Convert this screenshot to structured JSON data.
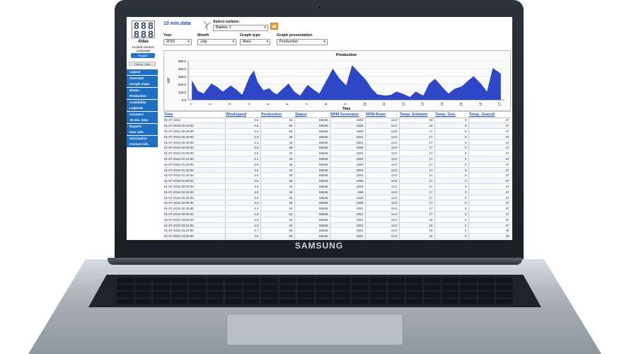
{
  "device": {
    "brand": "SAMSUNG"
  },
  "app": {
    "logo_text": "Atlas",
    "subtitle": "Hosted solution",
    "language_label": "Language",
    "language_value": "English",
    "theme_button": "Theme: Dark",
    "nav": [
      "Logout",
      "Overview",
      "Google maps",
      "Status",
      "Production",
      "Availability",
      "Logbook",
      "Counters",
      "10 min. data",
      "Reports",
      "User info.",
      "Information",
      "Contact info."
    ]
  },
  "page": {
    "title": "10 min.data",
    "select_turbine_label": "Select turbine:",
    "turbine_value": "Bække 1",
    "year_label": "Year",
    "year_value": "2015",
    "month_label": "Month",
    "month_value": "July",
    "graph_type_label": "Graph type",
    "graph_type_value": "Area",
    "graph_presentation_label": "Graph presentation",
    "graph_presentation_value": "Production"
  },
  "chart_data": {
    "type": "area",
    "title": "Production",
    "xlabel": "Time",
    "ylabel": "kW",
    "ylim": [
      0,
      580
    ],
    "yticks": [
      "580.0",
      "464.0",
      "348.0",
      "232.0",
      "116.0",
      "0.0"
    ],
    "xticks": [
      "1",
      "2",
      "3",
      "4",
      "5",
      "6",
      "7",
      "8",
      "9",
      "10",
      "11",
      "12",
      "13",
      "14",
      "15",
      "16",
      "17"
    ],
    "x": [
      1,
      1.3,
      1.6,
      2,
      2.3,
      2.6,
      3,
      3.3,
      3.6,
      4,
      4.2,
      4.4,
      4.7,
      5,
      5.2,
      5.4,
      5.7,
      6,
      6.3,
      6.6,
      7,
      7.3,
      7.6,
      8,
      8.3,
      8.6,
      9,
      9.3,
      9.6,
      10,
      10.3,
      10.6,
      11,
      11.3,
      11.6,
      12,
      12.3,
      12.6,
      13,
      13.3,
      13.6,
      14,
      14.3,
      14.6,
      15,
      15.3,
      15.6,
      16,
      16.3,
      16.6,
      17
    ],
    "values": [
      280,
      130,
      90,
      240,
      190,
      120,
      210,
      150,
      70,
      350,
      430,
      260,
      140,
      170,
      110,
      80,
      160,
      240,
      120,
      60,
      220,
      150,
      90,
      300,
      460,
      330,
      210,
      510,
      420,
      300,
      170,
      80,
      60,
      70,
      120,
      80,
      40,
      120,
      60,
      240,
      310,
      180,
      90,
      160,
      200,
      280,
      350,
      230,
      120,
      470,
      390
    ]
  },
  "table": {
    "headers": [
      "Time",
      "Windspeed",
      "Production",
      "Status",
      "RPM Generator",
      "RPM Rotor",
      "Temp. Ambient",
      "Temp. Gen.",
      "Temp. Gearoil"
    ],
    "rows": [
      [
        "01-07-2015",
        "4.8",
        "54",
        "65535",
        "1002",
        "13.0",
        "18",
        "0",
        "47"
      ],
      [
        "01-07-2015 00:10:00",
        "4.5",
        "52",
        "65535",
        "1000",
        "13.0",
        "18",
        "0",
        "47"
      ],
      [
        "01-07-2015 00:20:00",
        "4.4",
        "50",
        "65535",
        "1000",
        "13.0",
        "17",
        "0",
        "47"
      ],
      [
        "01-07-2015 00:30:00",
        "4.3",
        "46",
        "65535",
        "1001",
        "13.0",
        "17",
        "0",
        "47"
      ],
      [
        "01-07-2015 00:40:00",
        "4.1",
        "43",
        "65535",
        "1001",
        "13.0",
        "17",
        "0",
        "47"
      ],
      [
        "01-07-2015 00:50:00",
        "3.8",
        "38",
        "65535",
        "1000",
        "13.0",
        "17",
        "0",
        "47"
      ],
      [
        "01-07-2015 01:00:00",
        "3.8",
        "31",
        "65535",
        "1001",
        "13.0",
        "17",
        "0",
        "47"
      ],
      [
        "01-07-2015 01:10:00",
        "4.1",
        "40",
        "65535",
        "1000",
        "13.0",
        "17",
        "0",
        "47"
      ],
      [
        "01-07-2015 01:20:00",
        "3.9",
        "36",
        "65535",
        "1000",
        "13.0",
        "17",
        "0",
        "47"
      ],
      [
        "01-07-2015 01:30:00",
        "3.4",
        "24",
        "65535",
        "1001",
        "13.0",
        "17",
        "0",
        "47"
      ],
      [
        "01-07-2015 01:40:00",
        "3.5",
        "30",
        "65535",
        "1001",
        "13.0",
        "17",
        "0",
        "47"
      ],
      [
        "01-07-2015 01:50:00",
        "3.5",
        "26",
        "65535",
        "1000",
        "13.0",
        "17",
        "0",
        "47"
      ],
      [
        "01-07-2015 02:00:00",
        "3.4",
        "24",
        "65535",
        "1000",
        "13.0",
        "17",
        "0",
        "47"
      ],
      [
        "01-07-2015 02:10:00",
        "3.0",
        "19",
        "65535",
        "999",
        "13.0",
        "17",
        "0",
        "47"
      ],
      [
        "01-07-2015 02:20:00",
        "3.6",
        "30",
        "65535",
        "1000",
        "13.0",
        "17",
        "0",
        "47"
      ],
      [
        "01-07-2015 02:30:00",
        "4.2",
        "45",
        "65535",
        "1000",
        "13.0",
        "17",
        "0",
        "47"
      ],
      [
        "01-07-2015 02:40:00",
        "4.4",
        "52",
        "65535",
        "1001",
        "13.0",
        "17",
        "0",
        "47"
      ],
      [
        "01-07-2015 02:50:00",
        "4.8",
        "62",
        "65535",
        "1001",
        "13.0",
        "17",
        "0",
        "47"
      ],
      [
        "01-07-2015 03:00:00",
        "4.9",
        "64",
        "65535",
        "1001",
        "13.0",
        "16",
        "0",
        "47"
      ],
      [
        "01-07-2015 03:10:00",
        "4.8",
        "62",
        "65535",
        "1001",
        "13.0",
        "16",
        "0",
        "47"
      ],
      [
        "01-07-2015 03:20:00",
        "4.7",
        "59",
        "65535",
        "1001",
        "13.0",
        "16",
        "0",
        "48"
      ],
      [
        "01-07-2015 03:30:00",
        "4.6",
        "56",
        "65535",
        "1001",
        "13.0",
        "16",
        "0",
        "48"
      ]
    ]
  }
}
